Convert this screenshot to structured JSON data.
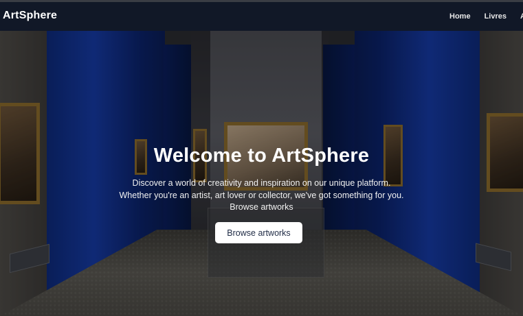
{
  "navbar": {
    "brand": "ArtSphere",
    "links": [
      {
        "label": "Home"
      },
      {
        "label": "Livres"
      },
      {
        "label": "Ab"
      }
    ]
  },
  "hero": {
    "title": "Welcome to ArtSphere",
    "subtitle_line1": "Discover a world of creativity and inspiration on our unique platform.",
    "subtitle_line2": "Whether you're an artist, art lover or collector, we've got something for you.",
    "subtitle_line3": "Browse artworks",
    "cta_label": "Browse artworks"
  },
  "colors": {
    "navbar_bg": "#111827",
    "button_bg": "#ffffff",
    "button_text": "#1e2a44",
    "gallery_blue": "#163aa3"
  }
}
